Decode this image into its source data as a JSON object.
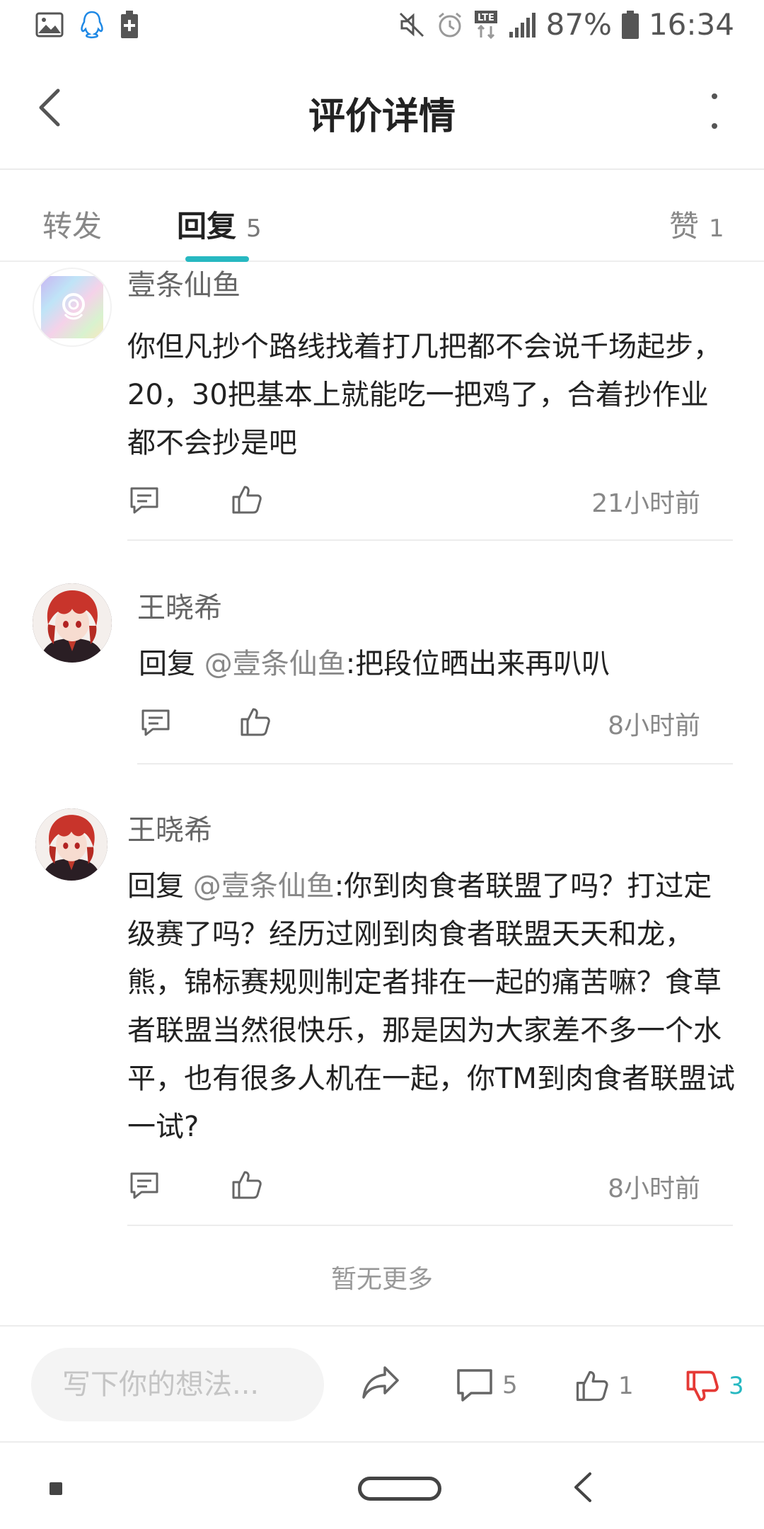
{
  "status_bar": {
    "battery": "87%",
    "time": "16:34",
    "left_icons": [
      "image-icon",
      "qq-penguin-icon",
      "battery-saver-icon"
    ],
    "right_icons": [
      "mute-icon",
      "alarm-icon",
      "lte-icon",
      "signal-icon",
      "battery-icon"
    ]
  },
  "header": {
    "title": "评价详情"
  },
  "tabs": [
    {
      "label": "转发",
      "count": ""
    },
    {
      "label": "回复",
      "count": "5"
    },
    {
      "label": "赞",
      "count": "1"
    }
  ],
  "active_tab": "回复",
  "accent_color": "#27b8c1",
  "comments": [
    {
      "username": "壹条仙鱼",
      "content": "你但凡抄个路线找着打几把都不会说千场起步，20，30把基本上就能吃一把鸡了，合着抄作业都不会抄是吧",
      "time": "21小时前"
    },
    {
      "username": "王晓希",
      "reply_prefix": "回复 ",
      "mention": "@壹条仙鱼",
      "content": ":把段位晒出来再叭叭",
      "time": "8小时前"
    },
    {
      "username": "王晓希",
      "reply_prefix": "回复 ",
      "mention": "@壹条仙鱼",
      "content": ":你到肉食者联盟了吗？打过定级赛了吗？经历过刚到肉食者联盟天天和龙，熊，锦标赛规则制定者排在一起的痛苦嘛？食草者联盟当然很快乐，那是因为大家差不多一个水平，也有很多人机在一起，你TM到肉食者联盟试一试?",
      "time": "8小时前"
    }
  ],
  "no_more_text": "暂无更多",
  "input_bar": {
    "placeholder": "写下你的想法...",
    "comment_count": "5",
    "like_count": "1",
    "dislike_count": "3",
    "dislike_color": "#e53935"
  }
}
